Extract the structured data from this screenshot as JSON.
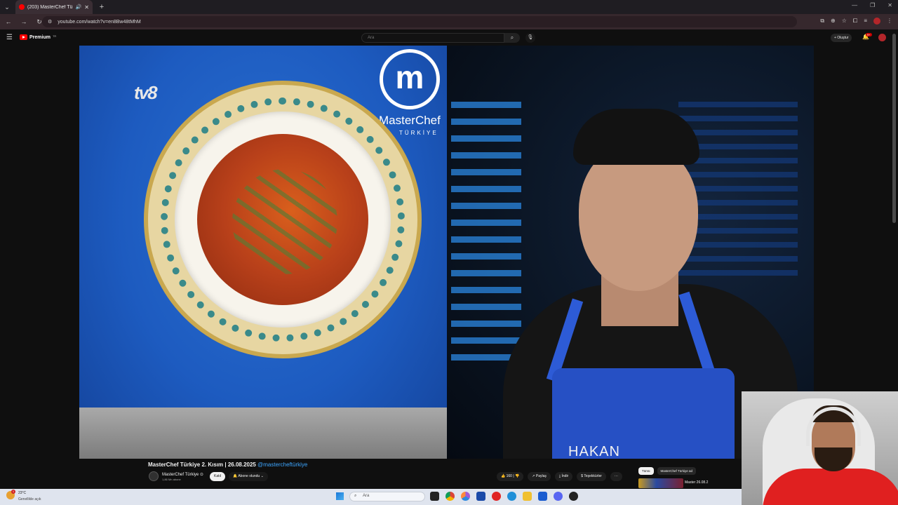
{
  "browser": {
    "tab_title": "(203) MasterChef Türkiye 2",
    "url": "youtube.com/watch?v=en8Bw48tMhM",
    "new_tab": "+"
  },
  "youtube": {
    "logo_text": "Premium",
    "logo_suffix": "TR",
    "search_placeholder": "Ara",
    "create_label": "+ Oluştur",
    "notification_count": "9+"
  },
  "video": {
    "broadcaster_logo": "tv8",
    "brand_name": "MasterChef",
    "brand_sub": "TÜRKİYE",
    "contestant_name": "HAKAN",
    "title": "MasterChef Türkiye 2. Kısım | 26.08.2025",
    "title_tag": "@mastercheftürkiye"
  },
  "channel": {
    "name": "MasterChef Türkiye ⊙",
    "subscribers": "1,86 Mn abone",
    "join_label": "Katıl",
    "subscribed_label": "Abone olundu ⌄"
  },
  "actions": {
    "like_count": "160",
    "dislike": "",
    "share": "Paylaş",
    "download": "İndir",
    "thanks": "Teşekkürler",
    "more": "···"
  },
  "sidebar": {
    "chips": [
      "Tümü",
      "MasterChef Türkiye ad"
    ],
    "next_video_title": "Master 26.08.2"
  },
  "taskbar": {
    "weather_badge": "1",
    "temperature": "23°C",
    "weather_desc": "Genellikle açık",
    "search_placeholder": "Ara"
  },
  "colors": {
    "youtube_red": "#ff0000",
    "link_blue": "#3ea6ff",
    "background": "#0f0f0f"
  }
}
